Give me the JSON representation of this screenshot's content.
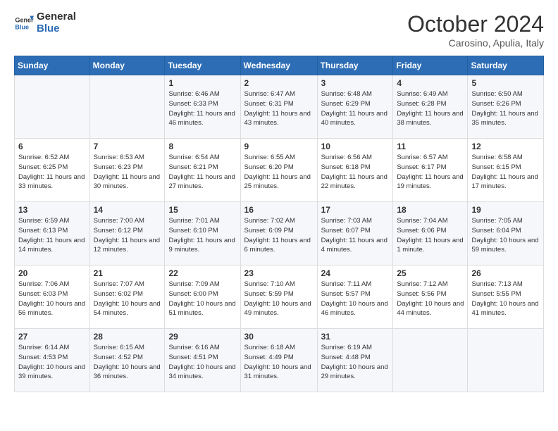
{
  "logo": {
    "line1": "General",
    "line2": "Blue"
  },
  "title": "October 2024",
  "subtitle": "Carosino, Apulia, Italy",
  "days_of_week": [
    "Sunday",
    "Monday",
    "Tuesday",
    "Wednesday",
    "Thursday",
    "Friday",
    "Saturday"
  ],
  "weeks": [
    [
      {
        "day": "",
        "info": ""
      },
      {
        "day": "",
        "info": ""
      },
      {
        "day": "1",
        "info": "Sunrise: 6:46 AM\nSunset: 6:33 PM\nDaylight: 11 hours and 46 minutes."
      },
      {
        "day": "2",
        "info": "Sunrise: 6:47 AM\nSunset: 6:31 PM\nDaylight: 11 hours and 43 minutes."
      },
      {
        "day": "3",
        "info": "Sunrise: 6:48 AM\nSunset: 6:29 PM\nDaylight: 11 hours and 40 minutes."
      },
      {
        "day": "4",
        "info": "Sunrise: 6:49 AM\nSunset: 6:28 PM\nDaylight: 11 hours and 38 minutes."
      },
      {
        "day": "5",
        "info": "Sunrise: 6:50 AM\nSunset: 6:26 PM\nDaylight: 11 hours and 35 minutes."
      }
    ],
    [
      {
        "day": "6",
        "info": "Sunrise: 6:52 AM\nSunset: 6:25 PM\nDaylight: 11 hours and 33 minutes."
      },
      {
        "day": "7",
        "info": "Sunrise: 6:53 AM\nSunset: 6:23 PM\nDaylight: 11 hours and 30 minutes."
      },
      {
        "day": "8",
        "info": "Sunrise: 6:54 AM\nSunset: 6:21 PM\nDaylight: 11 hours and 27 minutes."
      },
      {
        "day": "9",
        "info": "Sunrise: 6:55 AM\nSunset: 6:20 PM\nDaylight: 11 hours and 25 minutes."
      },
      {
        "day": "10",
        "info": "Sunrise: 6:56 AM\nSunset: 6:18 PM\nDaylight: 11 hours and 22 minutes."
      },
      {
        "day": "11",
        "info": "Sunrise: 6:57 AM\nSunset: 6:17 PM\nDaylight: 11 hours and 19 minutes."
      },
      {
        "day": "12",
        "info": "Sunrise: 6:58 AM\nSunset: 6:15 PM\nDaylight: 11 hours and 17 minutes."
      }
    ],
    [
      {
        "day": "13",
        "info": "Sunrise: 6:59 AM\nSunset: 6:13 PM\nDaylight: 11 hours and 14 minutes."
      },
      {
        "day": "14",
        "info": "Sunrise: 7:00 AM\nSunset: 6:12 PM\nDaylight: 11 hours and 12 minutes."
      },
      {
        "day": "15",
        "info": "Sunrise: 7:01 AM\nSunset: 6:10 PM\nDaylight: 11 hours and 9 minutes."
      },
      {
        "day": "16",
        "info": "Sunrise: 7:02 AM\nSunset: 6:09 PM\nDaylight: 11 hours and 6 minutes."
      },
      {
        "day": "17",
        "info": "Sunrise: 7:03 AM\nSunset: 6:07 PM\nDaylight: 11 hours and 4 minutes."
      },
      {
        "day": "18",
        "info": "Sunrise: 7:04 AM\nSunset: 6:06 PM\nDaylight: 11 hours and 1 minute."
      },
      {
        "day": "19",
        "info": "Sunrise: 7:05 AM\nSunset: 6:04 PM\nDaylight: 10 hours and 59 minutes."
      }
    ],
    [
      {
        "day": "20",
        "info": "Sunrise: 7:06 AM\nSunset: 6:03 PM\nDaylight: 10 hours and 56 minutes."
      },
      {
        "day": "21",
        "info": "Sunrise: 7:07 AM\nSunset: 6:02 PM\nDaylight: 10 hours and 54 minutes."
      },
      {
        "day": "22",
        "info": "Sunrise: 7:09 AM\nSunset: 6:00 PM\nDaylight: 10 hours and 51 minutes."
      },
      {
        "day": "23",
        "info": "Sunrise: 7:10 AM\nSunset: 5:59 PM\nDaylight: 10 hours and 49 minutes."
      },
      {
        "day": "24",
        "info": "Sunrise: 7:11 AM\nSunset: 5:57 PM\nDaylight: 10 hours and 46 minutes."
      },
      {
        "day": "25",
        "info": "Sunrise: 7:12 AM\nSunset: 5:56 PM\nDaylight: 10 hours and 44 minutes."
      },
      {
        "day": "26",
        "info": "Sunrise: 7:13 AM\nSunset: 5:55 PM\nDaylight: 10 hours and 41 minutes."
      }
    ],
    [
      {
        "day": "27",
        "info": "Sunrise: 6:14 AM\nSunset: 4:53 PM\nDaylight: 10 hours and 39 minutes."
      },
      {
        "day": "28",
        "info": "Sunrise: 6:15 AM\nSunset: 4:52 PM\nDaylight: 10 hours and 36 minutes."
      },
      {
        "day": "29",
        "info": "Sunrise: 6:16 AM\nSunset: 4:51 PM\nDaylight: 10 hours and 34 minutes."
      },
      {
        "day": "30",
        "info": "Sunrise: 6:18 AM\nSunset: 4:49 PM\nDaylight: 10 hours and 31 minutes."
      },
      {
        "day": "31",
        "info": "Sunrise: 6:19 AM\nSunset: 4:48 PM\nDaylight: 10 hours and 29 minutes."
      },
      {
        "day": "",
        "info": ""
      },
      {
        "day": "",
        "info": ""
      }
    ]
  ]
}
